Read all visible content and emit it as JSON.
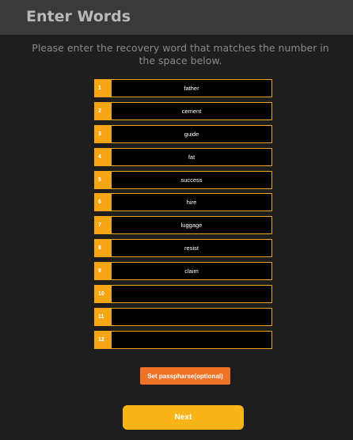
{
  "header": {
    "title": "Enter Words"
  },
  "instructions": "Please enter the recovery word that matches the number in the space below.",
  "words": [
    {
      "number": "1",
      "value": "father"
    },
    {
      "number": "2",
      "value": "cement"
    },
    {
      "number": "3",
      "value": "guide"
    },
    {
      "number": "4",
      "value": "fat"
    },
    {
      "number": "5",
      "value": "success"
    },
    {
      "number": "6",
      "value": "hire"
    },
    {
      "number": "7",
      "value": "luggage"
    },
    {
      "number": "8",
      "value": "resist"
    },
    {
      "number": "9",
      "value": "claim"
    },
    {
      "number": "10",
      "value": ""
    },
    {
      "number": "11",
      "value": ""
    },
    {
      "number": "12",
      "value": ""
    }
  ],
  "buttons": {
    "passphrase_label": "Set passpharse(optional)",
    "next_label": "Next"
  },
  "colors": {
    "accent": "#f4a615",
    "passphrase_button": "#f07226",
    "next_button": "#f9b418",
    "background": "#1e1e1e",
    "header": "#3a3a3a"
  }
}
